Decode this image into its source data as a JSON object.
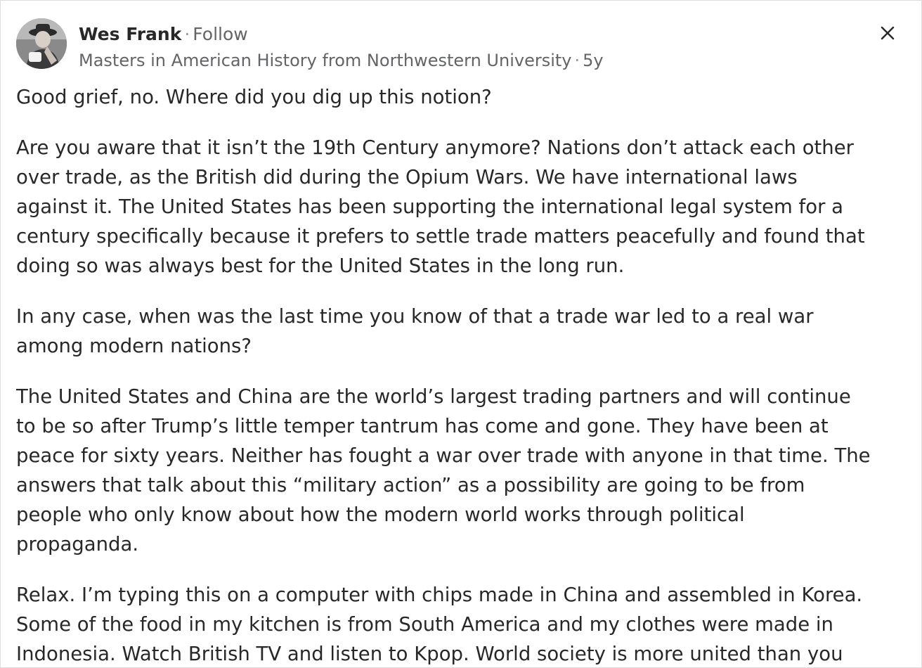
{
  "author": {
    "name": "Wes Frank",
    "follow_label": "Follow",
    "credential": "Masters in American History from Northwestern University",
    "age": "5y",
    "separator": "·"
  },
  "icons": {
    "avatar": "user-avatar-photo",
    "close": "close-icon"
  },
  "answer": {
    "paragraphs": [
      "Good grief, no. Where did you dig up this notion?",
      "Are you aware that it isn’t the 19th Century anymore? Nations don’t attack each other\nover trade, as the British did during the Opium Wars. We have international laws\nagainst it. The United States has been supporting the international legal system for a\ncentury specifically because it prefers to settle trade matters peacefully and found that\ndoing so was always best for the United States in the long run.",
      "In any case, when was the last time you know of that a trade war led to a real war\namong modern nations?",
      "The United States and China are the world’s largest trading partners and will continue\nto be so after Trump’s little temper tantrum has come and gone. They have been at\npeace for sixty years. Neither has fought a war over trade with anyone in that time. The\nanswers that talk about this “military action” as a possibility are going to be from\npeople who only know about how the modern world works through political\npropaganda.",
      "Relax. I’m typing this on a computer with chips made in China and assembled in Korea.\nSome of the food in my kitchen is from South America and my clothes were made in\nIndonesia. Watch British TV and listen to Kpop. World society is more united than you"
    ]
  },
  "colors": {
    "text": "#282829",
    "secondary_text": "#636466",
    "border": "#dedede"
  }
}
